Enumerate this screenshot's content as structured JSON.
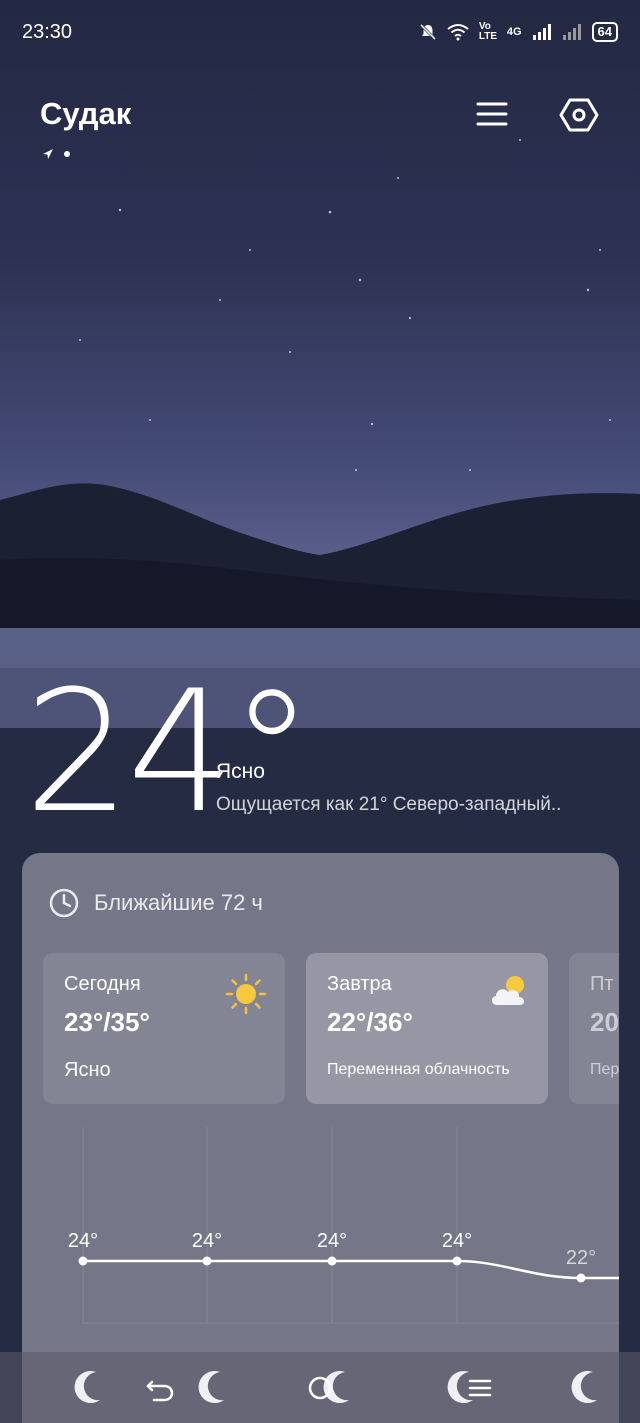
{
  "status_bar": {
    "time": "23:30",
    "volte": "Vo LTE",
    "network": "4G",
    "battery": "64"
  },
  "header": {
    "city": "Судак"
  },
  "current": {
    "temperature": "24°",
    "condition": "Ясно",
    "feels_like": "Ощущается как 21° Северо-западный.."
  },
  "forecast": {
    "title": "Ближайшие 72 ч",
    "days": [
      {
        "label": "Сегодня",
        "range": "23°/35°",
        "condition": "Ясно",
        "icon": "sun-icon"
      },
      {
        "label": "Завтра",
        "range": "22°/36°",
        "condition": "Переменная облачность",
        "icon": "partly-cloudy-icon"
      },
      {
        "label": "Пт",
        "range": "20",
        "condition": "Пер",
        "icon": "none"
      }
    ],
    "hourly": [
      {
        "temp": "24°",
        "label": "Ясно"
      },
      {
        "temp": "24°",
        "label": "Ясно"
      },
      {
        "temp": "24°",
        "label": "Ясно"
      },
      {
        "temp": "24°",
        "label": "Ясно"
      },
      {
        "temp": "22°",
        "label": "Ясно"
      }
    ]
  },
  "colors": {
    "sky_top": "#232843",
    "sky_horizon": "#7d77a8",
    "card": "#8c8c9b"
  }
}
